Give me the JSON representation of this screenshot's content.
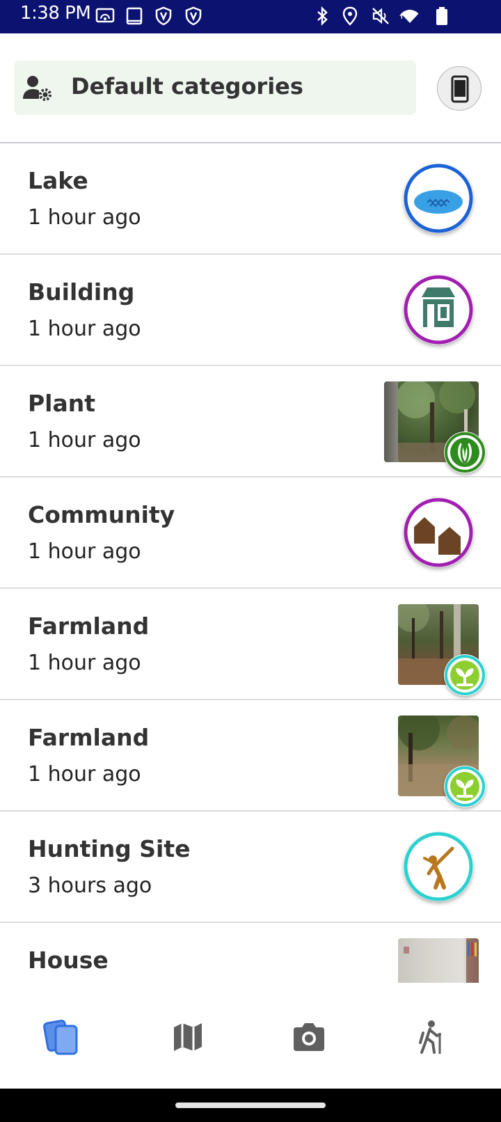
{
  "status_bar": {
    "time": "1:38 PM",
    "icons": [
      "cast-icon",
      "screenshot-icon",
      "vpn-shield-icon",
      "vpn-shield-icon",
      "bluetooth-icon",
      "location-icon",
      "mute-icon",
      "wifi-icon",
      "battery-icon"
    ]
  },
  "header": {
    "filter_label": "Default categories",
    "filter_icon": "user-settings-icon",
    "device_icon": "phone-icon"
  },
  "observations": [
    {
      "title": "Lake",
      "time": "1 hour ago",
      "category": "lake",
      "ring_color": "#1a62d6",
      "has_photo": false
    },
    {
      "title": "Building",
      "time": "1 hour ago",
      "category": "building",
      "ring_color": "#a11fb0",
      "has_photo": false
    },
    {
      "title": "Plant",
      "time": "1 hour ago",
      "category": "plant",
      "ring_color": "#2e8b1e",
      "has_photo": true
    },
    {
      "title": "Community",
      "time": "1 hour ago",
      "category": "community",
      "ring_color": "#a11fb0",
      "has_photo": false
    },
    {
      "title": "Farmland",
      "time": "1 hour ago",
      "category": "farmland",
      "ring_color": "#2bd0d0",
      "has_photo": true
    },
    {
      "title": "Farmland",
      "time": "1 hour ago",
      "category": "farmland",
      "ring_color": "#2bd0d0",
      "has_photo": true
    },
    {
      "title": "Hunting Site",
      "time": "3 hours ago",
      "category": "hunting",
      "ring_color": "#2bd0d0",
      "has_photo": false
    },
    {
      "title": "House",
      "time": "",
      "category": "house",
      "ring_color": "",
      "has_photo": true
    }
  ],
  "bottom_nav": {
    "items": [
      {
        "icon": "observations-list-icon",
        "active": true
      },
      {
        "icon": "map-icon",
        "active": false
      },
      {
        "icon": "camera-icon",
        "active": false
      },
      {
        "icon": "track-hiker-icon",
        "active": false
      }
    ],
    "active_color": "#2f6fe0",
    "inactive_color": "#5f5f5f"
  }
}
